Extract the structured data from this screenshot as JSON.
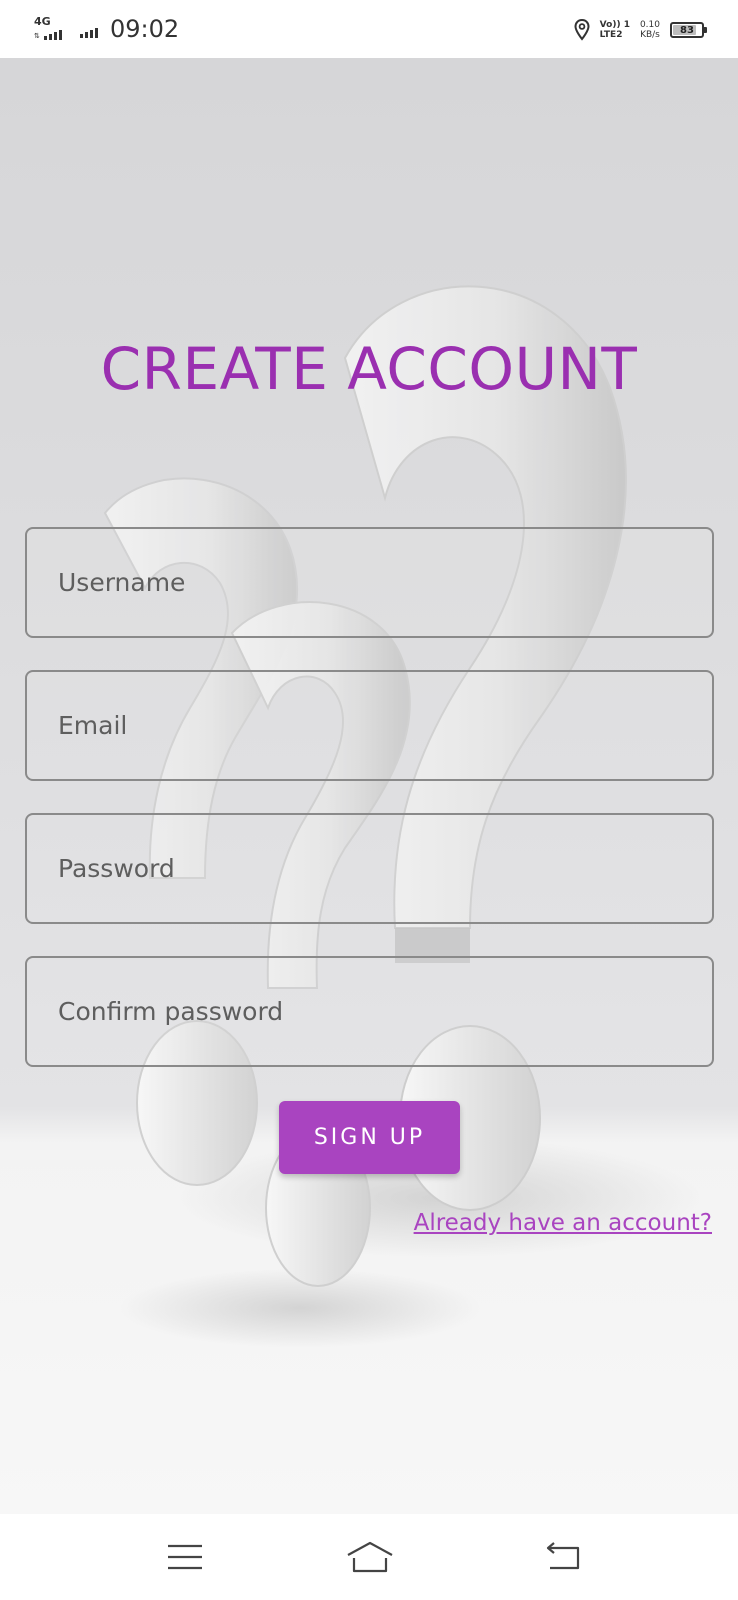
{
  "status_bar": {
    "network_type": "4G",
    "time": "09:02",
    "volte_line1": "Vo)) 1",
    "volte_line2": "LTE2",
    "net_speed_value": "0.10",
    "net_speed_unit": "KB/s",
    "battery_level": "83",
    "battery_fraction": 0.83,
    "icons": [
      "signal-4g-icon",
      "signal-bars-icon",
      "location-pin-icon",
      "battery-icon"
    ]
  },
  "title": "CREATE ACCOUNT",
  "form": {
    "username_placeholder": "Username",
    "email_placeholder": "Email",
    "password_placeholder": "Password",
    "confirm_password_placeholder": "Confirm password",
    "signup_label": "SIGN UP",
    "login_link": "Already have an account?"
  },
  "nav_bar": {
    "icons": [
      "menu-icon",
      "home-icon",
      "back-icon"
    ]
  },
  "colors": {
    "accent": "#a944c0",
    "title": "#9a2fb0",
    "field_border": "#8a8a8a"
  }
}
